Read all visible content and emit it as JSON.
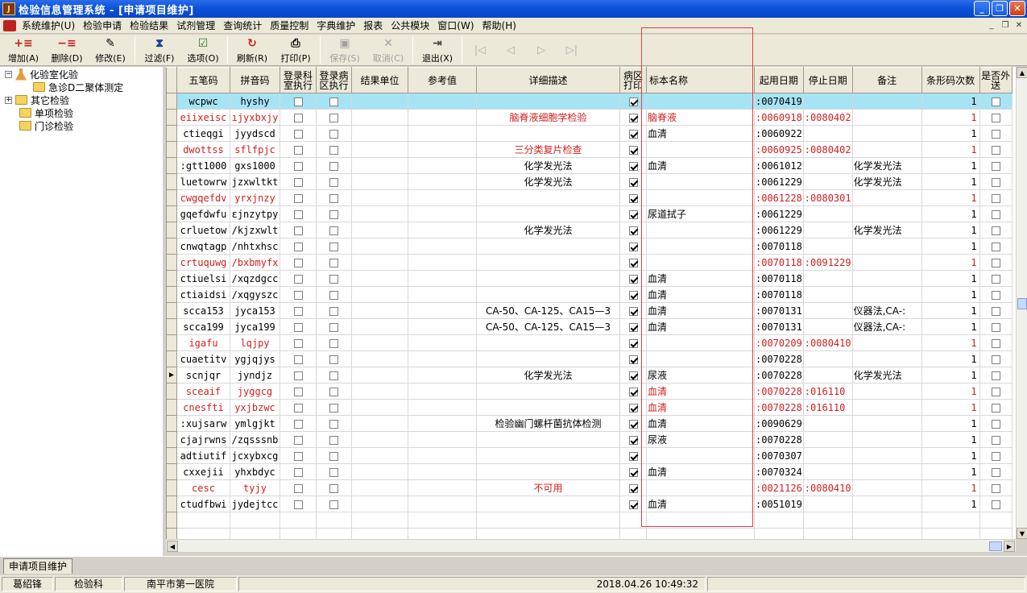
{
  "window": {
    "title": "检验信息管理系统 - [申请项目维护]"
  },
  "menu": [
    "系统维护(U)",
    "检验申请",
    "检验结果",
    "试剂管理",
    "查询统计",
    "质量控制",
    "字典维护",
    "报表",
    "公共模块",
    "窗口(W)",
    "帮助(H)"
  ],
  "toolbar": {
    "add": "增加(A)",
    "delete": "删除(D)",
    "edit": "修改(E)",
    "filter": "过滤(F)",
    "options": "选项(O)",
    "refresh": "刷新(R)",
    "print": "打印(P)",
    "save": "保存(S)",
    "cancel": "取消(C)",
    "exit": "退出(X)"
  },
  "tree": {
    "root": "化验室化验",
    "child": "急诊D二聚体测定",
    "others": [
      "其它检验",
      "单项检验",
      "门诊检验"
    ]
  },
  "columns": [
    "五笔码",
    "拼音码",
    "登录科室执行",
    "登录病区执行",
    "结果单位",
    "参考值",
    "详细描述",
    "病区打印",
    "标本名称",
    "起用日期",
    "停止日期",
    "备注",
    "条形码次数",
    "是否外送"
  ],
  "rows": [
    {
      "wb": "wcpwc",
      "py": "hyshy",
      "desc": "",
      "print": true,
      "spec": "",
      "start": ":0070419",
      "stop": "",
      "note": "",
      "cnt": "1",
      "red": false,
      "sel": true
    },
    {
      "wb": "eiixeisc",
      "py": "ıjyxbxjy",
      "desc": "脑脊液细胞学检验",
      "print": true,
      "spec": "脑脊液",
      "start": ":0060918",
      "stop": ":0080402",
      "note": "",
      "cnt": "1",
      "red": true
    },
    {
      "wb": "ctieqgi",
      "py": "jyydscd",
      "desc": "",
      "print": true,
      "spec": "血清",
      "start": ":0060922",
      "stop": "",
      "note": "",
      "cnt": "1",
      "red": false
    },
    {
      "wb": "dwottss",
      "py": "sflfpjc",
      "desc": "三分类复片检查",
      "print": true,
      "spec": "",
      "start": ":0060925",
      "stop": ":0080402",
      "note": "",
      "cnt": "1",
      "red": true
    },
    {
      "wb": ":gtt1000",
      "py": "gxs1000",
      "desc": "化学发光法",
      "print": true,
      "spec": "血清",
      "start": ":0061012",
      "stop": "",
      "note": "化学发光法",
      "cnt": "1",
      "red": false
    },
    {
      "wb": "luetowrw",
      "py": "jzxwltkt",
      "desc": "化学发光法",
      "print": true,
      "spec": "",
      "start": ":0061229",
      "stop": "",
      "note": "化学发光法",
      "cnt": "1",
      "red": false
    },
    {
      "wb": "cwgqefdv",
      "py": "yrxjnzy",
      "desc": "",
      "print": true,
      "spec": "",
      "start": ":0061228",
      "stop": ":0080301",
      "note": "",
      "cnt": "1",
      "red": true
    },
    {
      "wb": "gqefdwfu",
      "py": "ɛjnzytpy",
      "desc": "",
      "print": true,
      "spec": "尿道拭子",
      "start": ":0061229",
      "stop": "",
      "note": "",
      "cnt": "1",
      "red": false
    },
    {
      "wb": "crluetow",
      "py": "/kjzxwlt",
      "desc": "化学发光法",
      "print": true,
      "spec": "",
      "start": ":0061229",
      "stop": "",
      "note": "化学发光法",
      "cnt": "1",
      "red": false
    },
    {
      "wb": "cnwqtagp",
      "py": "/nhtxhsc",
      "desc": "",
      "print": true,
      "spec": "",
      "start": ":0070118",
      "stop": "",
      "note": "",
      "cnt": "1",
      "red": false
    },
    {
      "wb": "crtuquwg",
      "py": "/bxbmyfx",
      "desc": "",
      "print": true,
      "spec": "",
      "start": ":0070118",
      "stop": ":0091229",
      "note": "",
      "cnt": "1",
      "red": true
    },
    {
      "wb": "ctiuelsi",
      "py": "/xqzdgcc",
      "desc": "",
      "print": true,
      "spec": "血清",
      "start": ":0070118",
      "stop": "",
      "note": "",
      "cnt": "1",
      "red": false
    },
    {
      "wb": "ctiaidsi",
      "py": "/xqgyszc",
      "desc": "",
      "print": true,
      "spec": "血清",
      "start": ":0070118",
      "stop": "",
      "note": "",
      "cnt": "1",
      "red": false
    },
    {
      "wb": "scca153",
      "py": "jyca153",
      "desc": "CA-50、CA-125、CA15—3",
      "print": true,
      "spec": "血清",
      "start": ":0070131",
      "stop": "",
      "note": "仪器法,CA-:",
      "cnt": "1",
      "red": false
    },
    {
      "wb": "scca199",
      "py": "jyca199",
      "desc": "CA-50、CA-125、CA15—3",
      "print": true,
      "spec": "血清",
      "start": ":0070131",
      "stop": "",
      "note": "仪器法,CA-:",
      "cnt": "1",
      "red": false
    },
    {
      "wb": "igafu",
      "py": "lqjpy",
      "desc": "",
      "print": true,
      "spec": "",
      "start": ":0070209",
      "stop": ":0080410",
      "note": "",
      "cnt": "1",
      "red": true
    },
    {
      "wb": "cuaetitv",
      "py": "ygjqjys",
      "desc": "",
      "print": true,
      "spec": "",
      "start": ":0070228",
      "stop": "",
      "note": "",
      "cnt": "1",
      "red": false
    },
    {
      "wb": "scnjqr",
      "py": "jyndjz",
      "desc": "化学发光法",
      "print": true,
      "spec": "尿液",
      "start": ":0070228",
      "stop": "",
      "note": "化学发光法",
      "cnt": "1",
      "red": false,
      "cur": true
    },
    {
      "wb": "sceaif",
      "py": "jyggcg",
      "desc": "",
      "print": true,
      "spec": "血清",
      "start": ":0070228",
      "stop": ":016110",
      "note": "",
      "cnt": "1",
      "red": true
    },
    {
      "wb": "cnesfti",
      "py": "yxjbzwc",
      "desc": "",
      "print": true,
      "spec": "血清",
      "start": ":0070228",
      "stop": ":016110",
      "note": "",
      "cnt": "1",
      "red": true
    },
    {
      "wb": ":xujsarw",
      "py": "ymlgjkt",
      "desc": "检验幽门螺杆菌抗体检测",
      "print": true,
      "spec": "血清",
      "start": ":0090629",
      "stop": "",
      "note": "",
      "cnt": "1",
      "red": false
    },
    {
      "wb": "cjajrwns",
      "py": "/zqsssnb",
      "desc": "",
      "print": true,
      "spec": "尿液",
      "start": ":0070228",
      "stop": "",
      "note": "",
      "cnt": "1",
      "red": false
    },
    {
      "wb": "adtiutif",
      "py": "jcxybxcg",
      "desc": "",
      "print": true,
      "spec": "",
      "start": ":0070307",
      "stop": "",
      "note": "",
      "cnt": "1",
      "red": false
    },
    {
      "wb": "cxxejii",
      "py": "yhxbdyc",
      "desc": "",
      "print": true,
      "spec": "血清",
      "start": ":0070324",
      "stop": "",
      "note": "",
      "cnt": "1",
      "red": false
    },
    {
      "wb": "cesc",
      "py": "tyjy",
      "desc": "不可用",
      "print": true,
      "spec": "",
      "start": ":0021126",
      "stop": ":0080410",
      "note": "",
      "cnt": "1",
      "red": true
    },
    {
      "wb": "ctudfbwi",
      "py": "jydejtcc",
      "desc": "",
      "print": true,
      "spec": "血清",
      "start": ":0051019",
      "stop": "",
      "note": "",
      "cnt": "1",
      "red": false
    }
  ],
  "tab": "申请项目维护",
  "status": {
    "user": "葛绍锋",
    "dept": "检验科",
    "hospital": "南平市第一医院",
    "datetime": "2018.04.26 10:49:32"
  },
  "colors": {
    "selected_row": "#a6e4f5",
    "inactive_text": "#d02020",
    "titlebar": "#0a50d8"
  }
}
